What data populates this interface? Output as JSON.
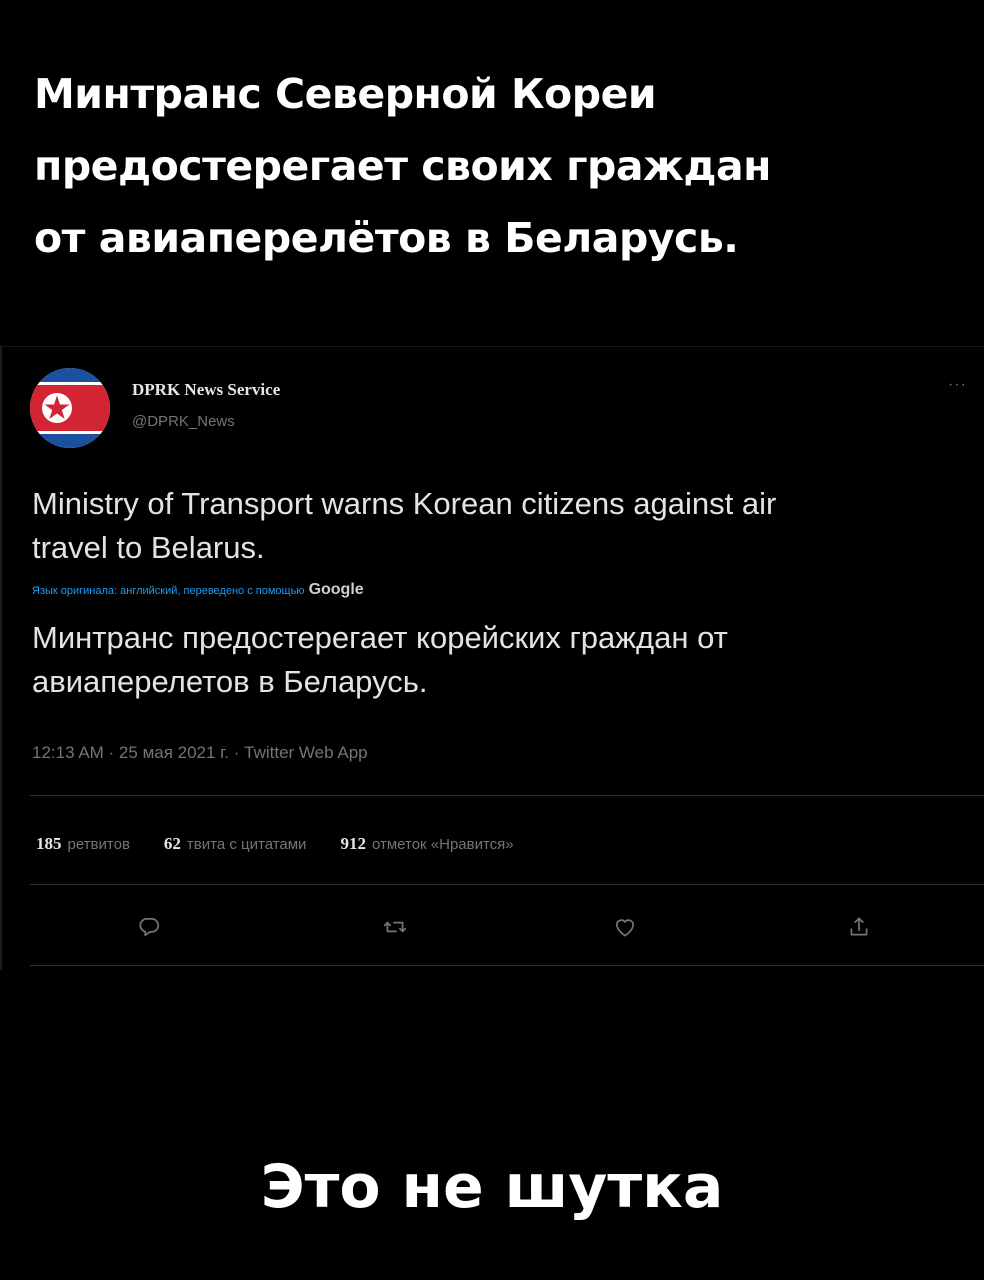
{
  "headline": {
    "lines": [
      "Минтранс Северной Кореи",
      "предостерегает своих граждан",
      "от авиаперелётов в Беларусь."
    ]
  },
  "tweet": {
    "display_name": "DPRK News Service",
    "handle": "@DPRK_News",
    "more_label": "···",
    "avatar_icon": "north-korea-flag",
    "text_lines": [
      "Ministry of Transport warns Korean citizens against air",
      "travel to Belarus."
    ],
    "translation_note": "Язык оригинала: английский, переведено с помощью",
    "translation_provider": "Google",
    "translated_lines": [
      "Минтранс предостерегает корейских граждан от",
      "авиаперелетов в Беларусь."
    ],
    "meta": "12:13 AM · 25 мая 2021 г. · Twitter Web App",
    "stats": {
      "retweets": {
        "count": "185",
        "label": "ретвитов"
      },
      "quotes": {
        "count": "62",
        "label": "твита с цитатами"
      },
      "likes": {
        "count": "912",
        "label": "отметок «Нравится»"
      }
    },
    "actions": [
      "reply-icon",
      "retweet-icon",
      "like-icon",
      "share-icon"
    ]
  },
  "footer": {
    "text": "Это не шутка"
  },
  "colors": {
    "background": "#000000",
    "text_primary": "#e3e3e3",
    "text_secondary": "#6e767d",
    "link": "#1d9bf0",
    "flag_red": "#d12533",
    "flag_blue": "#1b4fa0"
  }
}
